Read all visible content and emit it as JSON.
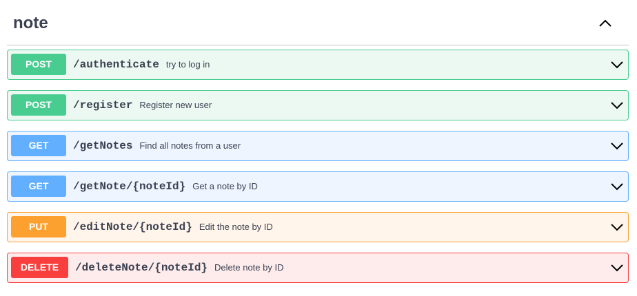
{
  "section": {
    "title": "note",
    "toggle_icon": "chevron-up-icon"
  },
  "operations": [
    {
      "method": "POST",
      "path": "/authenticate",
      "summary": "try to log in",
      "color": "#49cc90"
    },
    {
      "method": "POST",
      "path": "/register",
      "summary": "Register new user",
      "color": "#49cc90"
    },
    {
      "method": "GET",
      "path": "/getNotes",
      "summary": "Find all notes from a user",
      "color": "#61affe"
    },
    {
      "method": "GET",
      "path": "/getNote/{noteId}",
      "summary": "Get a note by ID",
      "color": "#61affe"
    },
    {
      "method": "PUT",
      "path": "/editNote/{noteId}",
      "summary": "Edit the note by ID",
      "color": "#fca130"
    },
    {
      "method": "DELETE",
      "path": "/deleteNote/{noteId}",
      "summary": "Delete note by ID",
      "color": "#f93e3e"
    }
  ]
}
